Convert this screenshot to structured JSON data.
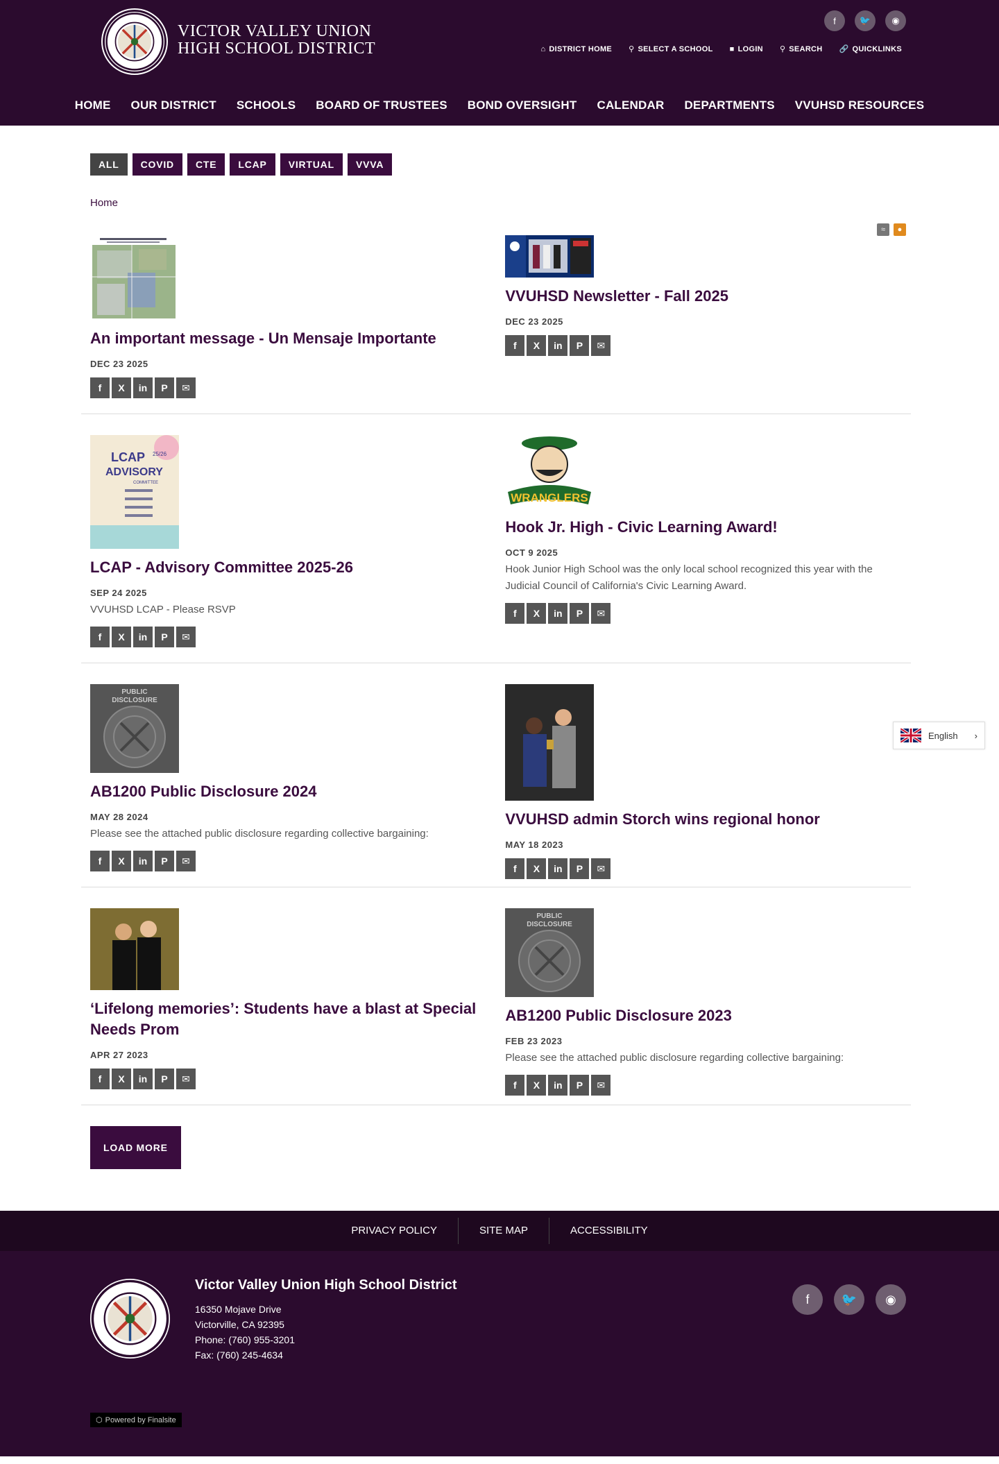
{
  "header": {
    "title_line1": "VICTOR VALLEY UNION",
    "title_line2": "HIGH SCHOOL DISTRICT",
    "social": [
      "facebook-icon",
      "twitter-icon",
      "instagram-icon"
    ],
    "utility": [
      {
        "label": "DISTRICT HOME",
        "icon": "home-icon"
      },
      {
        "label": "SELECT A SCHOOL",
        "icon": "map-pin-icon"
      },
      {
        "label": "LOGIN",
        "icon": "lock-icon"
      },
      {
        "label": "SEARCH",
        "icon": "search-icon"
      },
      {
        "label": "QUICKLINKS",
        "icon": "link-icon"
      }
    ],
    "nav": [
      "HOME",
      "OUR DISTRICT",
      "SCHOOLS",
      "BOARD OF TRUSTEES",
      "BOND OVERSIGHT",
      "CALENDAR",
      "DEPARTMENTS",
      "VVUHSD RESOURCES"
    ]
  },
  "filters": [
    "ALL",
    "COVID",
    "CTE",
    "LCAP",
    "VIRTUAL",
    "VVVA"
  ],
  "breadcrumb": "Home",
  "posts": [
    {
      "title": "An important message - Un Mensaje Importante",
      "date": "DEC 23 2025",
      "desc": ""
    },
    {
      "title": "VVUHSD Newsletter - Fall 2025",
      "date": "DEC 23 2025",
      "desc": ""
    },
    {
      "title": "LCAP - Advisory Committee 2025-26",
      "date": "SEP 24 2025",
      "desc": "VVUHSD LCAP  - Please RSVP"
    },
    {
      "title": "Hook Jr. High - Civic Learning Award!",
      "date": "OCT 9 2025",
      "desc": "Hook Junior High School was the only local school recognized this year with the Judicial Council of California's Civic Learning Award."
    },
    {
      "title": "AB1200 Public Disclosure 2024",
      "date": "MAY 28 2024",
      "desc": "Please see the attached public disclosure regarding collective bargaining:"
    },
    {
      "title": "VVUHSD admin Storch wins regional honor",
      "date": "MAY 18 2023",
      "desc": ""
    },
    {
      "title": "‘Lifelong memories’: Students have a blast at Special Needs Prom",
      "date": "APR 27 2023",
      "desc": ""
    },
    {
      "title": "AB1200 Public Disclosure 2023",
      "date": "FEB 23 2023",
      "desc": "Please see the attached public disclosure regarding collective bargaining:"
    }
  ],
  "thumb_text": {
    "lcap": "LCAP",
    "lcap_year": "25/26",
    "advisory": "ADVISORY",
    "committee": "COMMITTEE",
    "wranglers": "WRANGLERS",
    "public": "PUBLIC",
    "disclosure": "DISCLOSURE"
  },
  "load_more": "LOAD MORE",
  "footer": {
    "links": [
      "PRIVACY POLICY",
      "SITE MAP",
      "ACCESSIBILITY"
    ],
    "name": "Victor Valley Union High School District",
    "address1": "16350 Mojave Drive",
    "address2": "Victorville, CA  92395",
    "phone": "Phone: (760) 955-3201",
    "fax": "Fax: (760) 245-4634",
    "powered": "Powered by Finalsite"
  },
  "language": "English",
  "colors": {
    "brand": "#2b0b2e",
    "accent": "#3a0c3e"
  }
}
